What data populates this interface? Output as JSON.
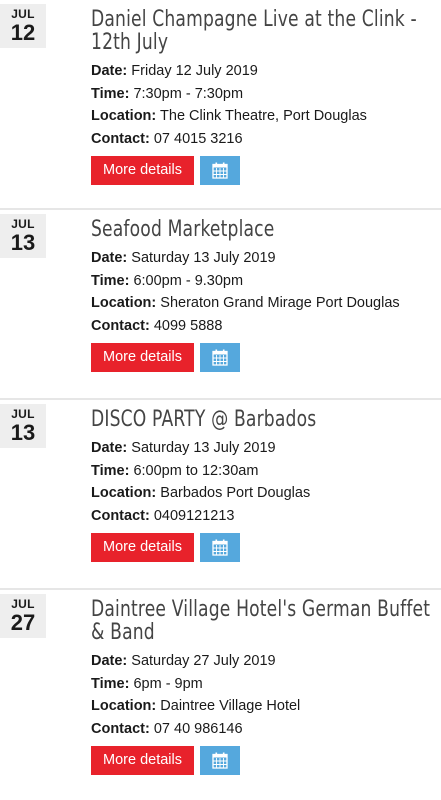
{
  "events": [
    {
      "month": "JUL",
      "day": "12",
      "title": "Daniel Champagne Live at the Clink - 12th July",
      "date_label": "Date:",
      "date": "Friday 12 July 2019",
      "time_label": "Time:",
      "time": "7:30pm - 7:30pm",
      "location_label": "Location:",
      "location": "The Clink Theatre, Port Douglas",
      "contact_label": "Contact:",
      "contact": "07 4015 3216",
      "more_label": "More details",
      "calendar_icon": "calendar-icon"
    },
    {
      "month": "JUL",
      "day": "13",
      "title": "Seafood Marketplace",
      "date_label": "Date:",
      "date": "Saturday 13 July 2019",
      "time_label": "Time:",
      "time": "6:00pm - 9.30pm",
      "location_label": "Location:",
      "location": "Sheraton Grand Mirage Port Douglas",
      "contact_label": "Contact:",
      "contact": "4099 5888",
      "more_label": "More details",
      "calendar_icon": "calendar-icon"
    },
    {
      "month": "JUL",
      "day": "13",
      "title": "DISCO PARTY @ Barbados",
      "date_label": "Date:",
      "date": "Saturday 13 July 2019",
      "time_label": "Time:",
      "time": "6:00pm to 12:30am",
      "location_label": "Location:",
      "location": "Barbados Port Douglas",
      "contact_label": "Contact:",
      "contact": "0409121213",
      "more_label": "More details",
      "calendar_icon": "calendar-icon"
    },
    {
      "month": "JUL",
      "day": "27",
      "title": "Daintree Village Hotel's German Buffet & Band",
      "date_label": "Date:",
      "date": "Saturday 27 July 2019",
      "time_label": "Time:",
      "time": "6pm - 9pm",
      "location_label": "Location:",
      "location": "Daintree Village Hotel",
      "contact_label": "Contact:",
      "contact": "07 40 986146",
      "more_label": "More details",
      "calendar_icon": "calendar-icon"
    }
  ],
  "colors": {
    "accent_red": "#e8222b",
    "accent_blue": "#55a8dd",
    "badge_bg": "#eeeeee",
    "title_gray": "#444444"
  }
}
